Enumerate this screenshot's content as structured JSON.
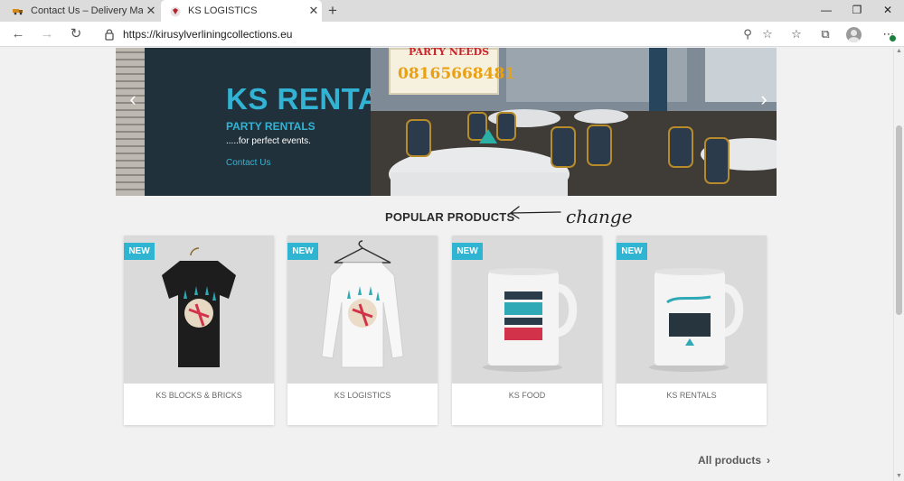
{
  "browser": {
    "tabs": [
      {
        "title": "Contact Us – Delivery Man",
        "active": false
      },
      {
        "title": "KS LOGISTICS",
        "active": true
      }
    ],
    "url": "https://kirusylverliningcollections.eu"
  },
  "hero": {
    "title": "KS RENTALS",
    "subtitle": "PARTY RENTALS",
    "tagline": ".....for perfect events.",
    "link": "Contact Us",
    "sign_top": "PARTY NEEDS",
    "sign_phone": "08165668481"
  },
  "section": {
    "title": "POPULAR PRODUCTS",
    "annotation": "change"
  },
  "products": [
    {
      "badge": "NEW",
      "name": "KS BLOCKS & BRICKS",
      "image": "black-tshirt"
    },
    {
      "badge": "NEW",
      "name": "KS LOGISTICS",
      "image": "white-longsleeve"
    },
    {
      "badge": "NEW",
      "name": "KS FOOD",
      "image": "best-mug"
    },
    {
      "badge": "NEW",
      "name": "KS RENTALS",
      "image": "adventure-mug"
    }
  ],
  "footer_link": "All products",
  "colors": {
    "accent": "#2fb5d2",
    "hero_panel": "#21313b",
    "hero_text": "#33b3d3"
  }
}
